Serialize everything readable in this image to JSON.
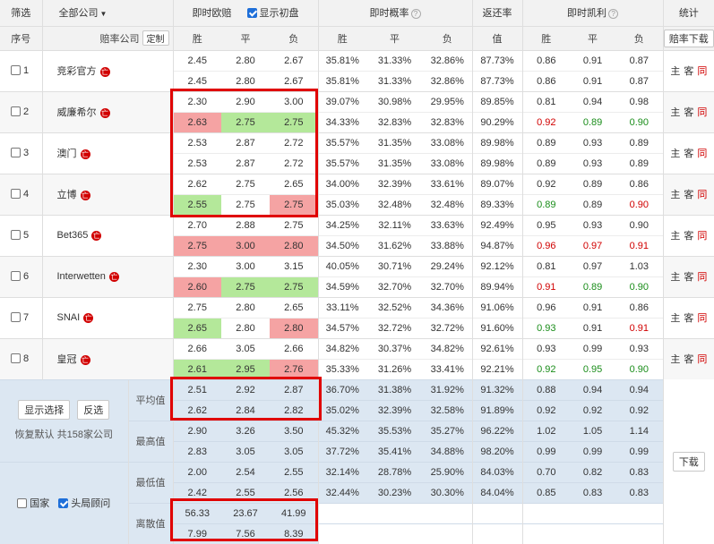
{
  "header": {
    "filter": "筛选",
    "all_companies": "全部公司",
    "instant_odds": "即时欧赔",
    "show_initial": "显示初盘",
    "instant_prob": "即时概率",
    "return_rate": "返还率",
    "instant_kelly": "即时凯利",
    "stats": "统计",
    "idx": "序号",
    "company": "赔率公司",
    "customize": "定制",
    "win": "胜",
    "draw": "平",
    "lose": "负",
    "value": "值",
    "download_odds": "赔率下载",
    "question": "?"
  },
  "company_tag": "亡",
  "action_home": "主",
  "action_away": "客",
  "action_same": "同",
  "companies": [
    {
      "idx": "1",
      "name": "竞彩官方",
      "rows": [
        {
          "o": [
            "2.45",
            "2.80",
            "2.67"
          ],
          "p": [
            "35.81%",
            "31.33%",
            "32.86%"
          ],
          "r": "87.73%",
          "k": [
            "0.86",
            "0.91",
            "0.87"
          ]
        },
        {
          "o": [
            "2.45",
            "2.80",
            "2.67"
          ],
          "p": [
            "35.81%",
            "31.33%",
            "32.86%"
          ],
          "r": "87.73%",
          "k": [
            "0.86",
            "0.91",
            "0.87"
          ]
        }
      ]
    },
    {
      "idx": "2",
      "name": "威廉希尔",
      "rows": [
        {
          "o": [
            "2.30",
            "2.90",
            "3.00"
          ],
          "p": [
            "39.07%",
            "30.98%",
            "29.95%"
          ],
          "r": "89.85%",
          "k": [
            "0.81",
            "0.94",
            "0.98"
          ]
        },
        {
          "o": [
            "2.63",
            "2.75",
            "2.75"
          ],
          "p": [
            "34.33%",
            "32.83%",
            "32.83%"
          ],
          "r": "90.29%",
          "k": [
            "0.92",
            "0.89",
            "0.90"
          ]
        }
      ]
    },
    {
      "idx": "3",
      "name": "澳门",
      "rows": [
        {
          "o": [
            "2.53",
            "2.87",
            "2.72"
          ],
          "p": [
            "35.57%",
            "31.35%",
            "33.08%"
          ],
          "r": "89.98%",
          "k": [
            "0.89",
            "0.93",
            "0.89"
          ]
        },
        {
          "o": [
            "2.53",
            "2.87",
            "2.72"
          ],
          "p": [
            "35.57%",
            "31.35%",
            "33.08%"
          ],
          "r": "89.98%",
          "k": [
            "0.89",
            "0.93",
            "0.89"
          ]
        }
      ]
    },
    {
      "idx": "4",
      "name": "立博",
      "rows": [
        {
          "o": [
            "2.62",
            "2.75",
            "2.65"
          ],
          "p": [
            "34.00%",
            "32.39%",
            "33.61%"
          ],
          "r": "89.07%",
          "k": [
            "0.92",
            "0.89",
            "0.86"
          ]
        },
        {
          "o": [
            "2.55",
            "2.75",
            "2.75"
          ],
          "p": [
            "35.03%",
            "32.48%",
            "32.48%"
          ],
          "r": "89.33%",
          "k": [
            "0.89",
            "0.89",
            "0.90"
          ]
        }
      ]
    },
    {
      "idx": "5",
      "name": "Bet365",
      "rows": [
        {
          "o": [
            "2.70",
            "2.88",
            "2.75"
          ],
          "p": [
            "34.25%",
            "32.11%",
            "33.63%"
          ],
          "r": "92.49%",
          "k": [
            "0.95",
            "0.93",
            "0.90"
          ]
        },
        {
          "o": [
            "2.75",
            "3.00",
            "2.80"
          ],
          "p": [
            "34.50%",
            "31.62%",
            "33.88%"
          ],
          "r": "94.87%",
          "k": [
            "0.96",
            "0.97",
            "0.91"
          ]
        }
      ]
    },
    {
      "idx": "6",
      "name": "Interwetten",
      "rows": [
        {
          "o": [
            "2.30",
            "3.00",
            "3.15"
          ],
          "p": [
            "40.05%",
            "30.71%",
            "29.24%"
          ],
          "r": "92.12%",
          "k": [
            "0.81",
            "0.97",
            "1.03"
          ]
        },
        {
          "o": [
            "2.60",
            "2.75",
            "2.75"
          ],
          "p": [
            "34.59%",
            "32.70%",
            "32.70%"
          ],
          "r": "89.94%",
          "k": [
            "0.91",
            "0.89",
            "0.90"
          ]
        }
      ]
    },
    {
      "idx": "7",
      "name": "SNAI",
      "rows": [
        {
          "o": [
            "2.75",
            "2.80",
            "2.65"
          ],
          "p": [
            "33.11%",
            "32.52%",
            "34.36%"
          ],
          "r": "91.06%",
          "k": [
            "0.96",
            "0.91",
            "0.86"
          ]
        },
        {
          "o": [
            "2.65",
            "2.80",
            "2.80"
          ],
          "p": [
            "34.57%",
            "32.72%",
            "32.72%"
          ],
          "r": "91.60%",
          "k": [
            "0.93",
            "0.91",
            "0.91"
          ]
        }
      ]
    },
    {
      "idx": "8",
      "name": "皇冠",
      "rows": [
        {
          "o": [
            "2.66",
            "3.05",
            "2.66"
          ],
          "p": [
            "34.82%",
            "30.37%",
            "34.82%"
          ],
          "r": "92.61%",
          "k": [
            "0.93",
            "0.99",
            "0.93"
          ]
        },
        {
          "o": [
            "2.61",
            "2.95",
            "2.76"
          ],
          "p": [
            "35.33%",
            "31.26%",
            "33.41%"
          ],
          "r": "92.21%",
          "k": [
            "0.92",
            "0.95",
            "0.90"
          ]
        }
      ]
    }
  ],
  "footer": {
    "show_selected": "显示选择",
    "invert": "反选",
    "restore": "恢复默认 共158家公司",
    "download": "下载",
    "national": "国家",
    "top_tier": "头局顾问",
    "stats": [
      {
        "label": "平均值",
        "rows": [
          {
            "o": [
              "2.51",
              "2.92",
              "2.87"
            ],
            "p": [
              "36.70%",
              "31.38%",
              "31.92%"
            ],
            "r": "91.32%",
            "k": [
              "0.88",
              "0.94",
              "0.94"
            ]
          },
          {
            "o": [
              "2.62",
              "2.84",
              "2.82"
            ],
            "p": [
              "35.02%",
              "32.39%",
              "32.58%"
            ],
            "r": "91.89%",
            "k": [
              "0.92",
              "0.92",
              "0.92"
            ]
          }
        ]
      },
      {
        "label": "最高值",
        "rows": [
          {
            "o": [
              "2.90",
              "3.26",
              "3.50"
            ],
            "p": [
              "45.32%",
              "35.53%",
              "35.27%"
            ],
            "r": "96.22%",
            "k": [
              "1.02",
              "1.05",
              "1.14"
            ]
          },
          {
            "o": [
              "2.83",
              "3.05",
              "3.05"
            ],
            "p": [
              "37.72%",
              "35.41%",
              "34.88%"
            ],
            "r": "98.20%",
            "k": [
              "0.99",
              "0.99",
              "0.99"
            ]
          }
        ]
      },
      {
        "label": "最低值",
        "rows": [
          {
            "o": [
              "2.00",
              "2.54",
              "2.55"
            ],
            "p": [
              "32.14%",
              "28.78%",
              "25.90%"
            ],
            "r": "84.03%",
            "k": [
              "0.70",
              "0.82",
              "0.83"
            ]
          },
          {
            "o": [
              "2.42",
              "2.55",
              "2.56"
            ],
            "p": [
              "32.44%",
              "30.23%",
              "30.30%"
            ],
            "r": "84.04%",
            "k": [
              "0.85",
              "0.83",
              "0.83"
            ]
          }
        ]
      },
      {
        "label": "离散值",
        "rows": [
          {
            "o": [
              "56.33",
              "23.67",
              "41.99"
            ],
            "p": [
              "",
              "",
              ""
            ],
            "r": "",
            "k": [
              "",
              "",
              ""
            ]
          },
          {
            "o": [
              "7.99",
              "7.56",
              "8.39"
            ],
            "p": [
              "",
              "",
              ""
            ],
            "r": "",
            "k": [
              "",
              "",
              ""
            ]
          }
        ]
      }
    ]
  },
  "colors": {
    "odds_up": "#f5a3a3",
    "odds_down": "#b4e89a",
    "kelly_red": "#d10000",
    "kelly_green": "#1a8d1a",
    "highlight": "#e00000"
  }
}
